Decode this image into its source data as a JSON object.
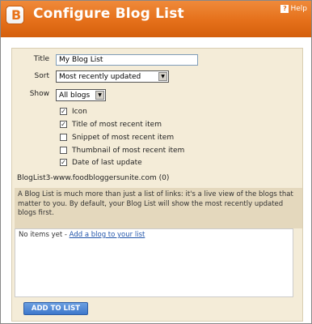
{
  "header": {
    "title": "Configure Blog List",
    "help_label": "Help",
    "logo_letter": "B",
    "brand_color": "#e5701a"
  },
  "form": {
    "title_label": "Title",
    "title_value": "My Blog List",
    "sort_label": "Sort",
    "sort_value": "Most recently updated",
    "show_label": "Show",
    "show_value": "All blogs"
  },
  "options": [
    {
      "label": "Icon",
      "checked": true
    },
    {
      "label": "Title of most recent item",
      "checked": true
    },
    {
      "label": "Snippet of most recent item",
      "checked": false
    },
    {
      "label": "Thumbnail of most recent item",
      "checked": false
    },
    {
      "label": "Date of last update",
      "checked": true
    }
  ],
  "list": {
    "name": "BlogList3-www.foodbloggersunite.com (0)",
    "description": "A Blog List is much more than just a list of links: it's a live view of the blogs that matter to you. By default, your Blog List will show the most recently updated blogs first.",
    "empty_text": "No items yet - ",
    "add_link": "Add a blog to your list",
    "add_button": "ADD TO LIST"
  }
}
